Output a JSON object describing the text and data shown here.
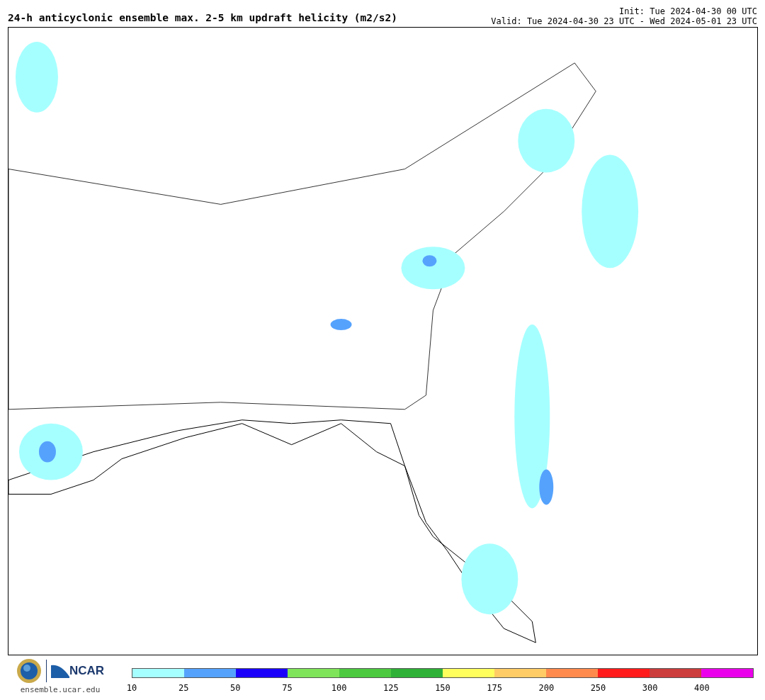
{
  "header": {
    "title": "24-h anticyclonic ensemble max. 2-5 km updraft helicity (m2/s2)",
    "init": "Init: Tue 2024-04-30 00 UTC",
    "valid": "Valid: Tue 2024-04-30 23 UTC - Wed 2024-05-01 23 UTC"
  },
  "footer": {
    "org": "NCAR",
    "url": "ensemble.ucar.edu"
  },
  "colorbar": [
    {
      "label": "10",
      "color": "#a6ffff"
    },
    {
      "label": "25",
      "color": "#55a2fd"
    },
    {
      "label": "50",
      "color": "#1a00fb"
    },
    {
      "label": "75",
      "color": "#80e45a"
    },
    {
      "label": "100",
      "color": "#4cc93f"
    },
    {
      "label": "125",
      "color": "#2fb138"
    },
    {
      "label": "150",
      "color": "#ffff5e"
    },
    {
      "label": "175",
      "color": "#ffcc66"
    },
    {
      "label": "200",
      "color": "#ff8a4e"
    },
    {
      "label": "250",
      "color": "#ff1b1b"
    },
    {
      "label": "300",
      "color": "#cc3d3d"
    },
    {
      "label": "400",
      "color": "#ea00ea"
    }
  ]
}
